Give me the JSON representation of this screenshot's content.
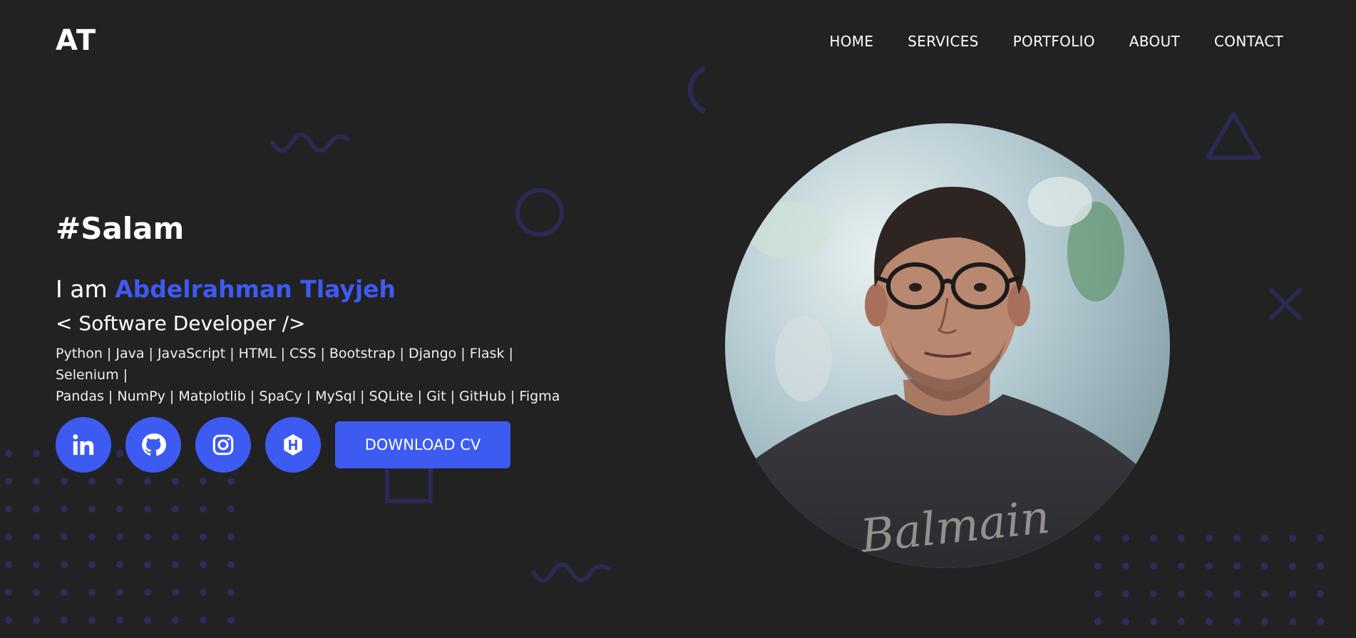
{
  "brand": {
    "logo_text": "AT"
  },
  "nav": {
    "items": [
      {
        "label": "HOME"
      },
      {
        "label": "SERVICES"
      },
      {
        "label": "PORTFOLIO"
      },
      {
        "label": "ABOUT"
      },
      {
        "label": "CONTACT"
      }
    ]
  },
  "hero": {
    "greeting": "#Salam",
    "intro_prefix": "I am",
    "name": "Abdelrahman Tlayjeh",
    "role": "< Software Developer />",
    "skills_line1": "Python | Java | JavaScript | HTML | CSS | Bootstrap | Django | Flask | Selenium |",
    "skills_line2": "Pandas | NumPy | Matplotlib | SpaCy | MySql | SQLite | Git | GitHub | Figma",
    "cv_button": "DOWNLOAD CV"
  },
  "socials": [
    {
      "icon": "linkedin-icon"
    },
    {
      "icon": "github-icon"
    },
    {
      "icon": "instagram-icon"
    },
    {
      "icon": "hackerrank-icon"
    }
  ],
  "colors": {
    "background": "#222223",
    "accent": "#3d5af1",
    "decoration": "#2b2a55",
    "text": "#ffffff"
  },
  "photo": {
    "shirt_text": "Balmain"
  }
}
